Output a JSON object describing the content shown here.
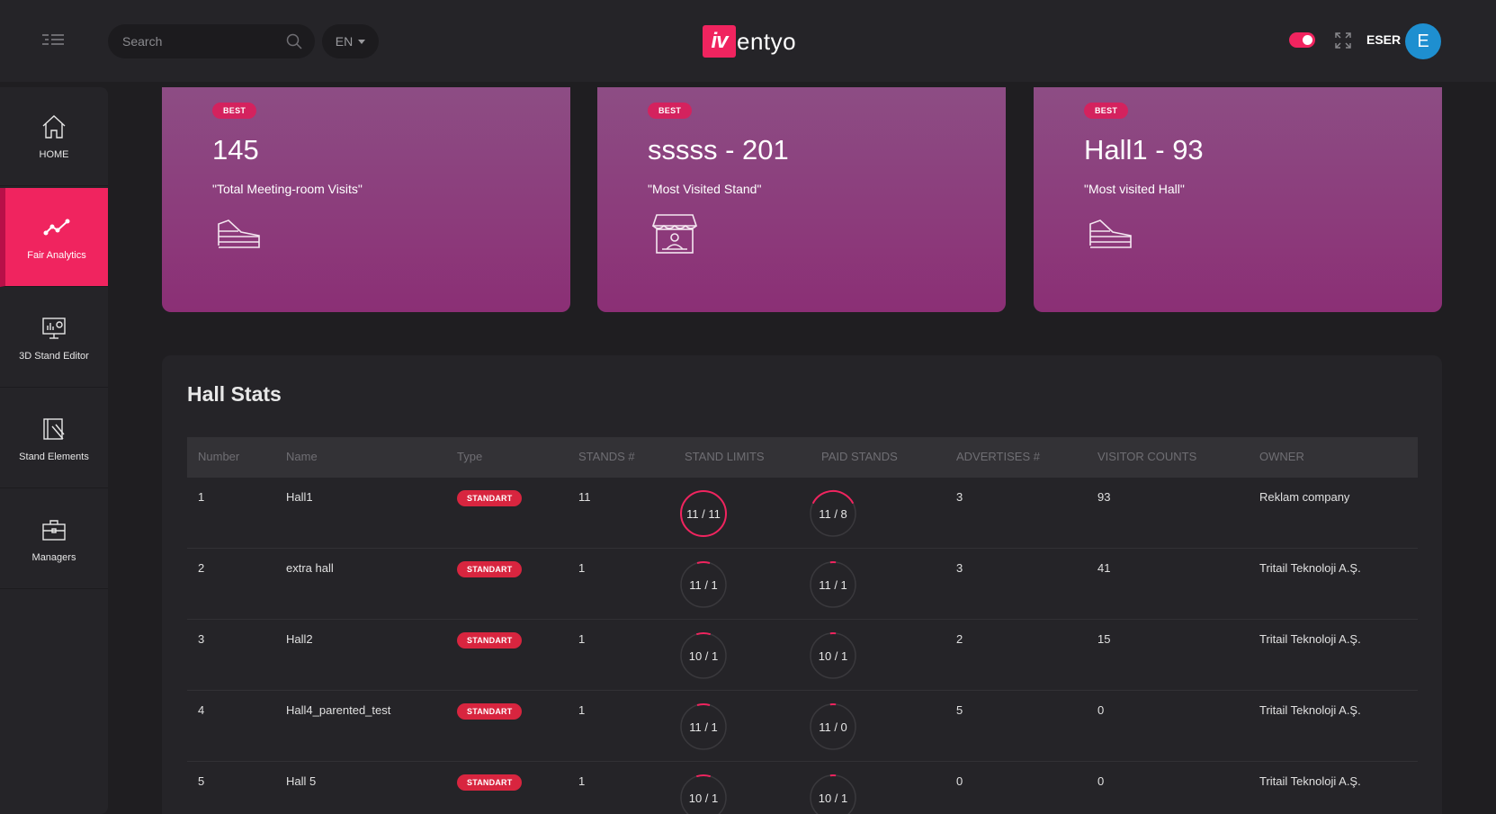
{
  "header": {
    "search_placeholder": "Search",
    "language": "EN",
    "logo_mark": "iv",
    "logo_text": "entyo",
    "username": "ESER",
    "avatar_initial": "E",
    "accent_color": "#f0245f"
  },
  "sidebar": {
    "items": [
      {
        "label": "HOME",
        "icon": "home-icon",
        "active": false
      },
      {
        "label": "Fair Analytics",
        "icon": "analytics-icon",
        "active": true
      },
      {
        "label": "3D Stand Editor",
        "icon": "monitor-icon",
        "active": false
      },
      {
        "label": "Stand Elements",
        "icon": "elements-icon",
        "active": false
      },
      {
        "label": "Managers",
        "icon": "briefcase-icon",
        "active": false
      }
    ]
  },
  "cards": [
    {
      "badge": "BEST",
      "value": "145",
      "description": "\"Total Meeting-room Visits\"",
      "icon": "hall-icon"
    },
    {
      "badge": "BEST",
      "value": "sssss - 201",
      "description": "\"Most Visited Stand\"",
      "icon": "stand-icon"
    },
    {
      "badge": "BEST",
      "value": "Hall1 - 93",
      "description": "\"Most visited Hall\"",
      "icon": "hall-icon"
    }
  ],
  "hall_stats": {
    "title": "Hall Stats",
    "columns": [
      "Number",
      "Name",
      "Type",
      "STANDS #",
      "STAND LIMITS",
      "PAID STANDS",
      "ADVERTISES #",
      "VISITOR COUNTS",
      "OWNER"
    ],
    "rows": [
      {
        "number": "1",
        "name": "Hall1",
        "type": "STANDART",
        "stands": "11",
        "stand_limits": "11 / 11",
        "stand_limits_fill": 1.0,
        "paid_stands": "11 / 8",
        "paid_fill": 0.35,
        "advertises": "3",
        "visitors": "93",
        "owner": "Reklam company"
      },
      {
        "number": "2",
        "name": "extra hall",
        "type": "STANDART",
        "stands": "1",
        "stand_limits": "11 / 1",
        "stand_limits_fill": 0.09,
        "paid_stands": "11 / 1",
        "paid_fill": 0.04,
        "advertises": "3",
        "visitors": "41",
        "owner": "Tritail Teknoloji A.Ş."
      },
      {
        "number": "3",
        "name": "Hall2",
        "type": "STANDART",
        "stands": "1",
        "stand_limits": "10 / 1",
        "stand_limits_fill": 0.1,
        "paid_stands": "10 / 1",
        "paid_fill": 0.04,
        "advertises": "2",
        "visitors": "15",
        "owner": "Tritail Teknoloji A.Ş."
      },
      {
        "number": "4",
        "name": "Hall4_parented_test",
        "type": "STANDART",
        "stands": "1",
        "stand_limits": "11 / 1",
        "stand_limits_fill": 0.09,
        "paid_stands": "11 / 0",
        "paid_fill": 0.04,
        "advertises": "5",
        "visitors": "0",
        "owner": "Tritail Teknoloji A.Ş."
      },
      {
        "number": "5",
        "name": "Hall 5",
        "type": "STANDART",
        "stands": "1",
        "stand_limits": "10 / 1",
        "stand_limits_fill": 0.1,
        "paid_stands": "10 / 1",
        "paid_fill": 0.04,
        "advertises": "0",
        "visitors": "0",
        "owner": "Tritail Teknoloji A.Ş."
      }
    ]
  }
}
